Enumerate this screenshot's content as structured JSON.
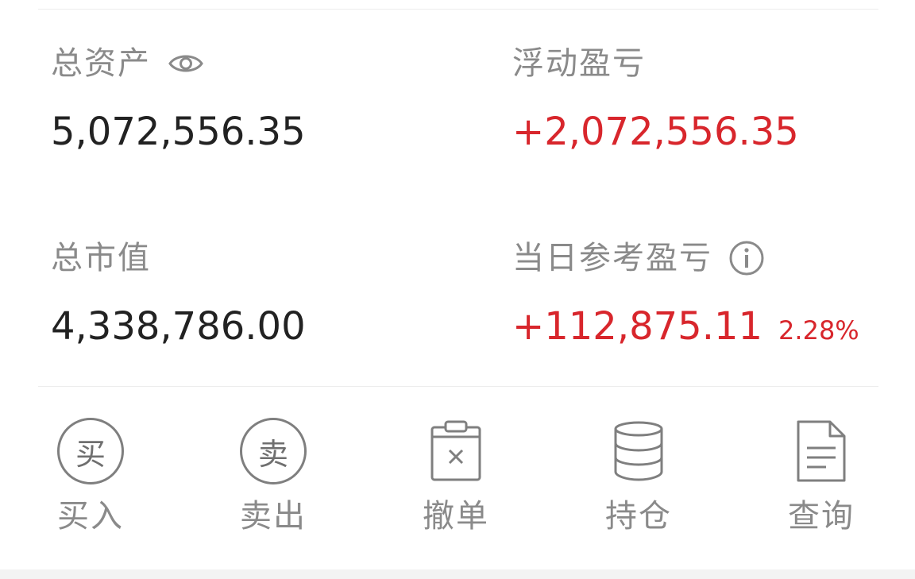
{
  "assets": {
    "total_assets": {
      "label": "总资产",
      "value": "5,072,556.35",
      "icon": "eye-icon"
    },
    "floating_pnl": {
      "label": "浮动盈亏",
      "value": "+2,072,556.35"
    },
    "total_market_value": {
      "label": "总市值",
      "value": "4,338,786.00"
    },
    "daily_ref_pnl": {
      "label": "当日参考盈亏",
      "value": "+112,875.11",
      "percent": "2.28%",
      "icon": "info-icon"
    }
  },
  "actions": [
    {
      "label": "买入",
      "icon_char": "买",
      "icon": "buy-circle-icon"
    },
    {
      "label": "卖出",
      "icon_char": "卖",
      "icon": "sell-circle-icon"
    },
    {
      "label": "撤单",
      "icon": "cancel-order-clipboard-icon"
    },
    {
      "label": "持仓",
      "icon": "holdings-database-icon"
    },
    {
      "label": "查询",
      "icon": "query-document-icon"
    }
  ],
  "colors": {
    "gain": "#d8262c",
    "label": "#8a8a8a",
    "value": "#222222"
  }
}
